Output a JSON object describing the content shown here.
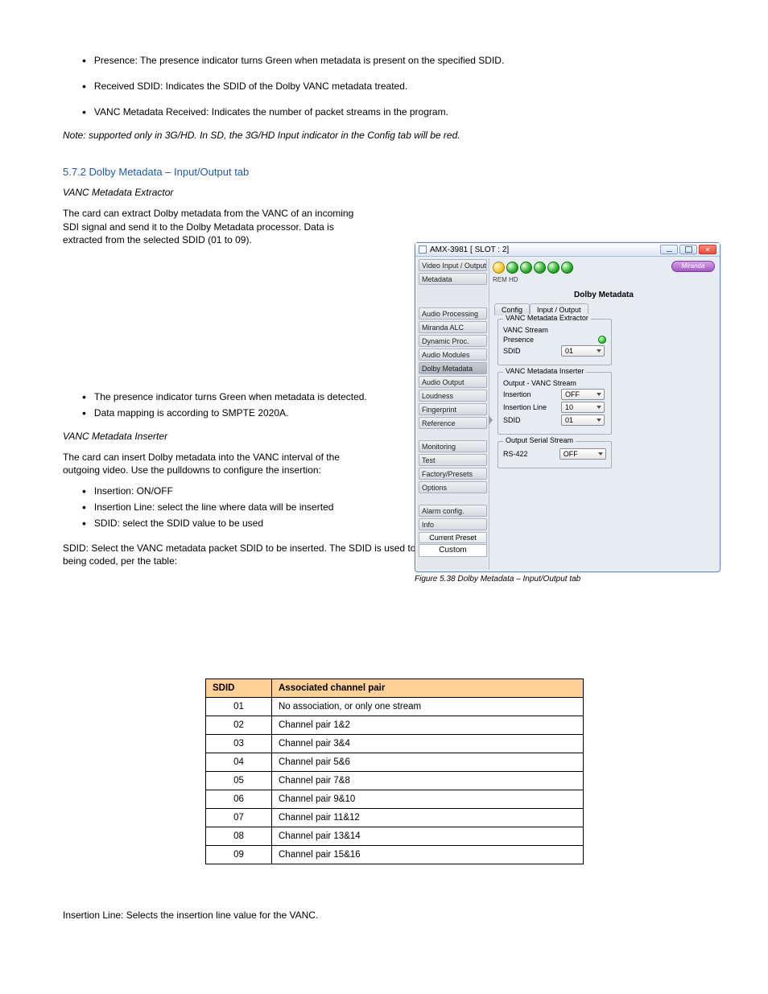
{
  "doc": {
    "top_bullets": [
      "Presence: The presence indicator turns Green when metadata is present on the specified SDID.",
      "Received SDID: Indicates the SDID of the Dolby VANC metadata treated.",
      "VANC Metadata Received: Indicates the number of packet streams in the program."
    ],
    "top_note": "Note: supported only in 3G/HD. In SD, the 3G/HD Input indicator in the Config tab will be red.",
    "section_io_title": "5.7.2  Dolby Metadata – Input/Output tab",
    "vanc_ext": {
      "p1": "VANC Metadata Extractor",
      "p2": "The card can extract Dolby metadata from the VANC of an incoming SDI signal and send it to the Dolby Metadata processor. Data is extracted from the selected SDID (01 to 09).",
      "bullets": [
        "The presence indicator turns Green when metadata is detected.",
        "Data mapping is according to SMPTE 2020A."
      ]
    },
    "vanc_ins": {
      "title": "VANC Metadata Inserter",
      "p": "The card can insert Dolby metadata into the VANC interval of the outgoing video. Use the pulldowns to configure the insertion:",
      "bullets": [
        "Insertion: ON/OFF",
        "Insertion Line: select the line where data will be inserted",
        "SDID: select the SDID value to be used"
      ],
      "sdid_p": "SDID: Select the VANC metadata packet SDID to be inserted. The SDID is used to identify the channel pair associated with the program that is being coded, per the table:"
    },
    "table": {
      "headers": [
        "SDID",
        "Associated channel pair"
      ],
      "rows": [
        [
          "01",
          "No association, or only one stream"
        ],
        [
          "02",
          "Channel pair 1&2"
        ],
        [
          "03",
          "Channel pair 3&4"
        ],
        [
          "04",
          "Channel pair 5&6"
        ],
        [
          "05",
          "Channel pair 7&8"
        ],
        [
          "06",
          "Channel pair 9&10"
        ],
        [
          "07",
          "Channel pair 11&12"
        ],
        [
          "08",
          "Channel pair 13&14"
        ],
        [
          "09",
          "Channel pair 15&16"
        ]
      ]
    },
    "after_table": "Insertion Line: Selects the insertion line value for the VANC.",
    "figure_caption": "Figure 5.38  Dolby Metadata – Input/Output tab"
  },
  "app": {
    "title": "AMX-3981 [ SLOT : 2]",
    "brand": "Miranda",
    "rem": "REM   HD",
    "panel_title": "Dolby Metadata",
    "sidebar": {
      "items": [
        "Video Input / Output",
        "Metadata",
        "Audio Processing",
        "Miranda ALC",
        "Dynamic Proc.",
        "Audio Modules",
        "Dolby Metadata",
        "Audio Output",
        "Loudness",
        "Fingerprint",
        "Reference",
        "Monitoring",
        "Test",
        "Factory/Presets",
        "Options",
        "Alarm config.",
        "Info"
      ],
      "current_preset_label": "Current Preset",
      "custom_label": "Custom"
    },
    "tabs": {
      "config": "Config",
      "io": "Input / Output"
    },
    "groups": {
      "ext": {
        "legend": "VANC Metadata Extractor",
        "sub": "VANC Stream",
        "presence_label": "Presence",
        "sdid_label": "SDID",
        "sdid_value": "01"
      },
      "ins": {
        "legend": "VANC Metadata Inserter",
        "sub": "Output - VANC Stream",
        "insertion_label": "Insertion",
        "insertion_value": "OFF",
        "insertion_line_label": "Insertion Line",
        "insertion_line_value": "10",
        "sdid_label": "SDID",
        "sdid_value": "01"
      },
      "oss": {
        "legend": "Output Serial Stream",
        "rs_label": "RS-422",
        "rs_value": "OFF"
      }
    }
  }
}
